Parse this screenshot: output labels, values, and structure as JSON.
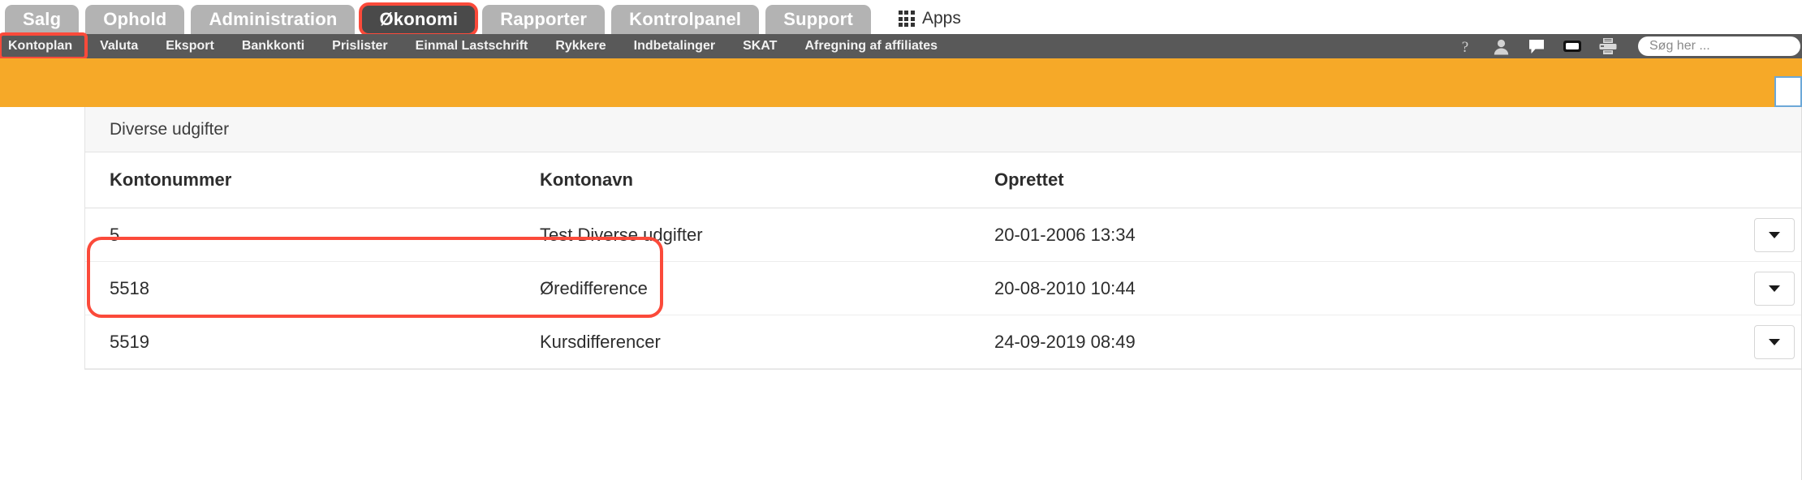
{
  "topnav": {
    "tabs": [
      {
        "label": "Salg",
        "active": false,
        "highlighted": false
      },
      {
        "label": "Ophold",
        "active": false,
        "highlighted": false
      },
      {
        "label": "Administration",
        "active": false,
        "highlighted": false
      },
      {
        "label": "Økonomi",
        "active": true,
        "highlighted": true
      },
      {
        "label": "Rapporter",
        "active": false,
        "highlighted": false
      },
      {
        "label": "Kontrolpanel",
        "active": false,
        "highlighted": false
      },
      {
        "label": "Support",
        "active": false,
        "highlighted": false
      }
    ],
    "apps_label": "Apps",
    "apps_icon": "apps-grid-icon"
  },
  "subnav": {
    "items": [
      {
        "label": "Kontoplan",
        "marked": true
      },
      {
        "label": "Valuta",
        "marked": false
      },
      {
        "label": "Eksport",
        "marked": false
      },
      {
        "label": "Bankkonti",
        "marked": false
      },
      {
        "label": "Prislister",
        "marked": false
      },
      {
        "label": "Einmal Lastschrift",
        "marked": false
      },
      {
        "label": "Rykkere",
        "marked": false
      },
      {
        "label": "Indbetalinger",
        "marked": false
      },
      {
        "label": "SKAT",
        "marked": false
      },
      {
        "label": "Afregning af affiliates",
        "marked": false
      }
    ],
    "icons": [
      "help-question-icon",
      "user-profile-icon",
      "chat-bubble-icon",
      "screen-display-icon",
      "printer-icon"
    ],
    "search_placeholder": "Søg her ..."
  },
  "card": {
    "title": "Diverse udgifter",
    "columns": [
      "Kontonummer",
      "Kontonavn",
      "Oprettet"
    ],
    "rows": [
      {
        "kontonummer": "5",
        "kontonavn": "Test Diverse udgifter",
        "oprettet": "20-01-2006 13:34",
        "action_icon": "chevron-down-icon"
      },
      {
        "kontonummer": "5518",
        "kontonavn": "Øredifference",
        "oprettet": "20-08-2010 10:44",
        "action_icon": "chevron-down-icon"
      },
      {
        "kontonummer": "5519",
        "kontonavn": "Kursdifferencer",
        "oprettet": "24-09-2019 08:49",
        "action_icon": "chevron-down-icon"
      }
    ]
  },
  "colors": {
    "brand_orange": "#f6a928",
    "annotation_red": "#fb4a3a",
    "nav_dark": "#595959",
    "tab_inactive": "#b3b3b3",
    "tab_active": "#4a4a4a"
  }
}
